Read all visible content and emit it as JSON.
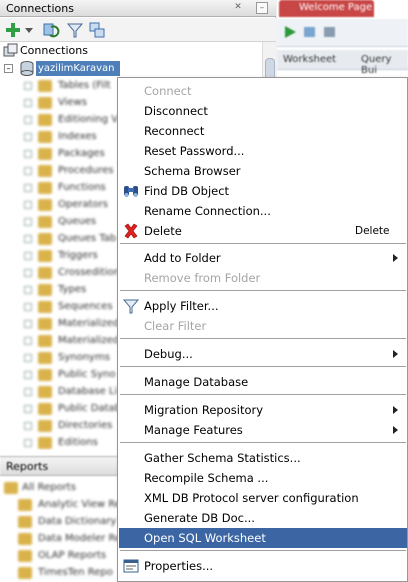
{
  "connections_panel": {
    "title": "Connections",
    "root_label": "Connections",
    "selected_connection": "yazilimKaravan",
    "tree_items": [
      "Tables (Filt",
      "Views",
      "Editioning V",
      "Indexes",
      "Packages",
      "Procedures",
      "Functions",
      "Operators",
      "Queues",
      "Queues Tab",
      "Triggers",
      "Crossedition",
      "Types",
      "Sequences",
      "Materialized",
      "Materialized",
      "Synonyms",
      "Public Syno",
      "Database Li",
      "Public Datab",
      "Directories",
      "Editions"
    ]
  },
  "reports_panel": {
    "title": "Reports",
    "items": [
      "All Reports",
      "Analytic View Re",
      "Data Dictionary",
      "Data Modeler Re",
      "OLAP Reports",
      "TimesTen Repo"
    ]
  },
  "editor": {
    "welcome_tab": "Welcome Page",
    "worksheet_tab": "Worksheet",
    "query_builder_tab": "Query Bui"
  },
  "context_menu": {
    "items": [
      {
        "id": "connect",
        "label": "Connect",
        "disabled": true
      },
      {
        "id": "disconnect",
        "label": "Disconnect"
      },
      {
        "id": "reconnect",
        "label": "Reconnect"
      },
      {
        "id": "reset-password",
        "label": "Reset Password..."
      },
      {
        "id": "schema-browser",
        "label": "Schema Browser"
      },
      {
        "id": "find-db-object",
        "label": "Find DB Object",
        "icon": "binoculars-icon"
      },
      {
        "id": "rename-connection",
        "label": "Rename Connection..."
      },
      {
        "id": "delete",
        "label": "Delete",
        "shortcut": "Delete",
        "icon": "red-x-icon"
      },
      {
        "id": "add-to-folder",
        "label": "Add to Folder",
        "submenu": true
      },
      {
        "id": "remove-from-folder",
        "label": "Remove from Folder",
        "disabled": true
      },
      {
        "id": "apply-filter",
        "label": "Apply Filter...",
        "icon": "filter-icon"
      },
      {
        "id": "clear-filter",
        "label": "Clear Filter",
        "disabled": true
      },
      {
        "id": "debug",
        "label": "Debug...",
        "submenu": true
      },
      {
        "id": "manage-database",
        "label": "Manage Database"
      },
      {
        "id": "migration-repository",
        "label": "Migration Repository",
        "submenu": true
      },
      {
        "id": "manage-features",
        "label": "Manage Features",
        "submenu": true
      },
      {
        "id": "gather-schema-statistics",
        "label": "Gather Schema Statistics..."
      },
      {
        "id": "recompile-schema",
        "label": "Recompile Schema ..."
      },
      {
        "id": "xml-db-protocol",
        "label": "XML DB Protocol server configuration"
      },
      {
        "id": "generate-db-doc",
        "label": "Generate DB Doc..."
      },
      {
        "id": "open-sql-worksheet",
        "label": "Open SQL Worksheet",
        "highlighted": true
      },
      {
        "id": "properties",
        "label": "Properties...",
        "icon": "properties-icon"
      }
    ]
  },
  "colors": {
    "menu_highlight": "#3c66a3",
    "disabled_text": "#a4a4a4",
    "selection": "#4f7fb8"
  }
}
